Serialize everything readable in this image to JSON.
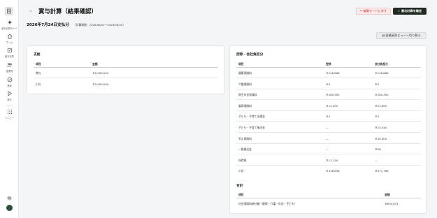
{
  "sidebar": {
    "items": [
      {
        "label": "給与計算ガイド",
        "icon": "sparkle-icon"
      },
      {
        "label": "ホーム",
        "icon": "home-icon"
      },
      {
        "label": "給与計算",
        "icon": "pencil-icon"
      },
      {
        "label": "従業員",
        "icon": "people-icon"
      },
      {
        "label": "承認",
        "icon": "check-circle-icon"
      },
      {
        "label": "実行",
        "icon": "play-icon"
      },
      {
        "label": "メニュー",
        "icon": "grid-icon"
      }
    ]
  },
  "header": {
    "title": "賞与計算（結果確認）",
    "edit_button": "編集モードに戻す",
    "confirm_button": "賞与計算を確定"
  },
  "summary": {
    "pay_date": "2026年7月24日支払分",
    "period": "（計算期間：2026/06/01〜2026/06/30）",
    "switch_button": "従業員別ビューへ切り替え"
  },
  "payments": {
    "title": "支給",
    "col_item": "項目",
    "col_amount": "金額",
    "rows": [
      {
        "item": "賞与",
        "amount": "￥2,900,000"
      },
      {
        "item": "小計",
        "amount": "￥2,900,000"
      }
    ]
  },
  "deductions": {
    "title": "控除・会社負担分",
    "col_item": "項目",
    "col_deduction": "控除",
    "col_company": "会社負担分",
    "rows": [
      {
        "item": "健康保険料",
        "deduction": "￥146,868",
        "company": "￥146,868"
      },
      {
        "item": "介護保険料",
        "deduction": "￥0",
        "company": "￥0"
      },
      {
        "item": "厚生年金保険料",
        "deduction": "￥265,350",
        "company": "￥265,350"
      },
      {
        "item": "雇用保険料",
        "deduction": "￥14,500",
        "company": "￥24,650"
      },
      {
        "item": "子ども・子育て支援金",
        "deduction": "￥0",
        "company": "￥0"
      },
      {
        "item": "子ども・子育て拠出金",
        "deduction": "—",
        "company": "￥10,440"
      },
      {
        "item": "労災保険料",
        "deduction": "—",
        "company": "￥30,400"
      },
      {
        "item": "一般拠出金",
        "deduction": "—",
        "company": "￥58"
      },
      {
        "item": "所得税",
        "deduction": "￥12,120",
        "company": "—"
      },
      {
        "item": "小計",
        "deduction": "￥438,838",
        "company": "￥477,766"
      }
    ]
  },
  "totals": {
    "title": "合計",
    "col_item": "項目",
    "col_amount": "金額",
    "rows": [
      {
        "item": "社会保険料納付額（健保・介護・年金・子ども）",
        "amount": "￥834,874"
      }
    ]
  }
}
